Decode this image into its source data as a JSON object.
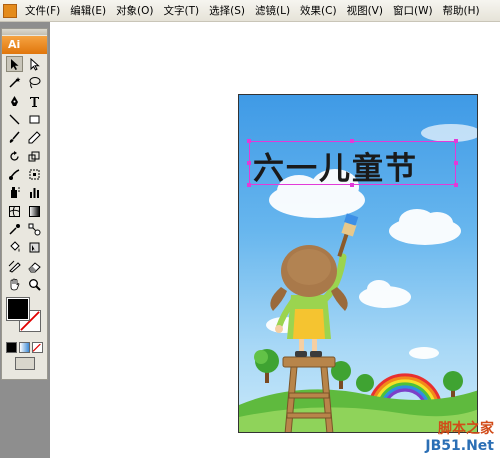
{
  "menubar": {
    "items": [
      "文件(F)",
      "编辑(E)",
      "对象(O)",
      "文字(T)",
      "选择(S)",
      "滤镜(L)",
      "效果(C)",
      "视图(V)",
      "窗口(W)",
      "帮助(H)"
    ]
  },
  "toolbox": {
    "logo": "Ai",
    "tools": [
      [
        "selection-tool",
        "direct-selection-tool"
      ],
      [
        "magic-wand-tool",
        "lasso-tool"
      ],
      [
        "pen-tool",
        "type-tool"
      ],
      [
        "line-segment-tool",
        "rectangle-tool"
      ],
      [
        "paintbrush-tool",
        "pencil-tool"
      ],
      [
        "rotate-tool",
        "scale-tool"
      ],
      [
        "warp-tool",
        "free-transform-tool"
      ],
      [
        "symbol-sprayer-tool",
        "column-graph-tool"
      ],
      [
        "mesh-tool",
        "gradient-tool"
      ],
      [
        "eyedropper-tool",
        "blend-tool"
      ],
      [
        "live-paint-bucket-tool",
        "live-paint-selection-tool"
      ],
      [
        "slice-tool",
        "eraser-tool"
      ],
      [
        "hand-tool",
        "zoom-tool"
      ]
    ],
    "fill_color": "#000000",
    "stroke_color": "none"
  },
  "document": {
    "title_text": "六一儿童节",
    "selection_color": "#e33ad8"
  },
  "watermark": {
    "line1": "脚本之家",
    "line2": "JB51.Net"
  }
}
